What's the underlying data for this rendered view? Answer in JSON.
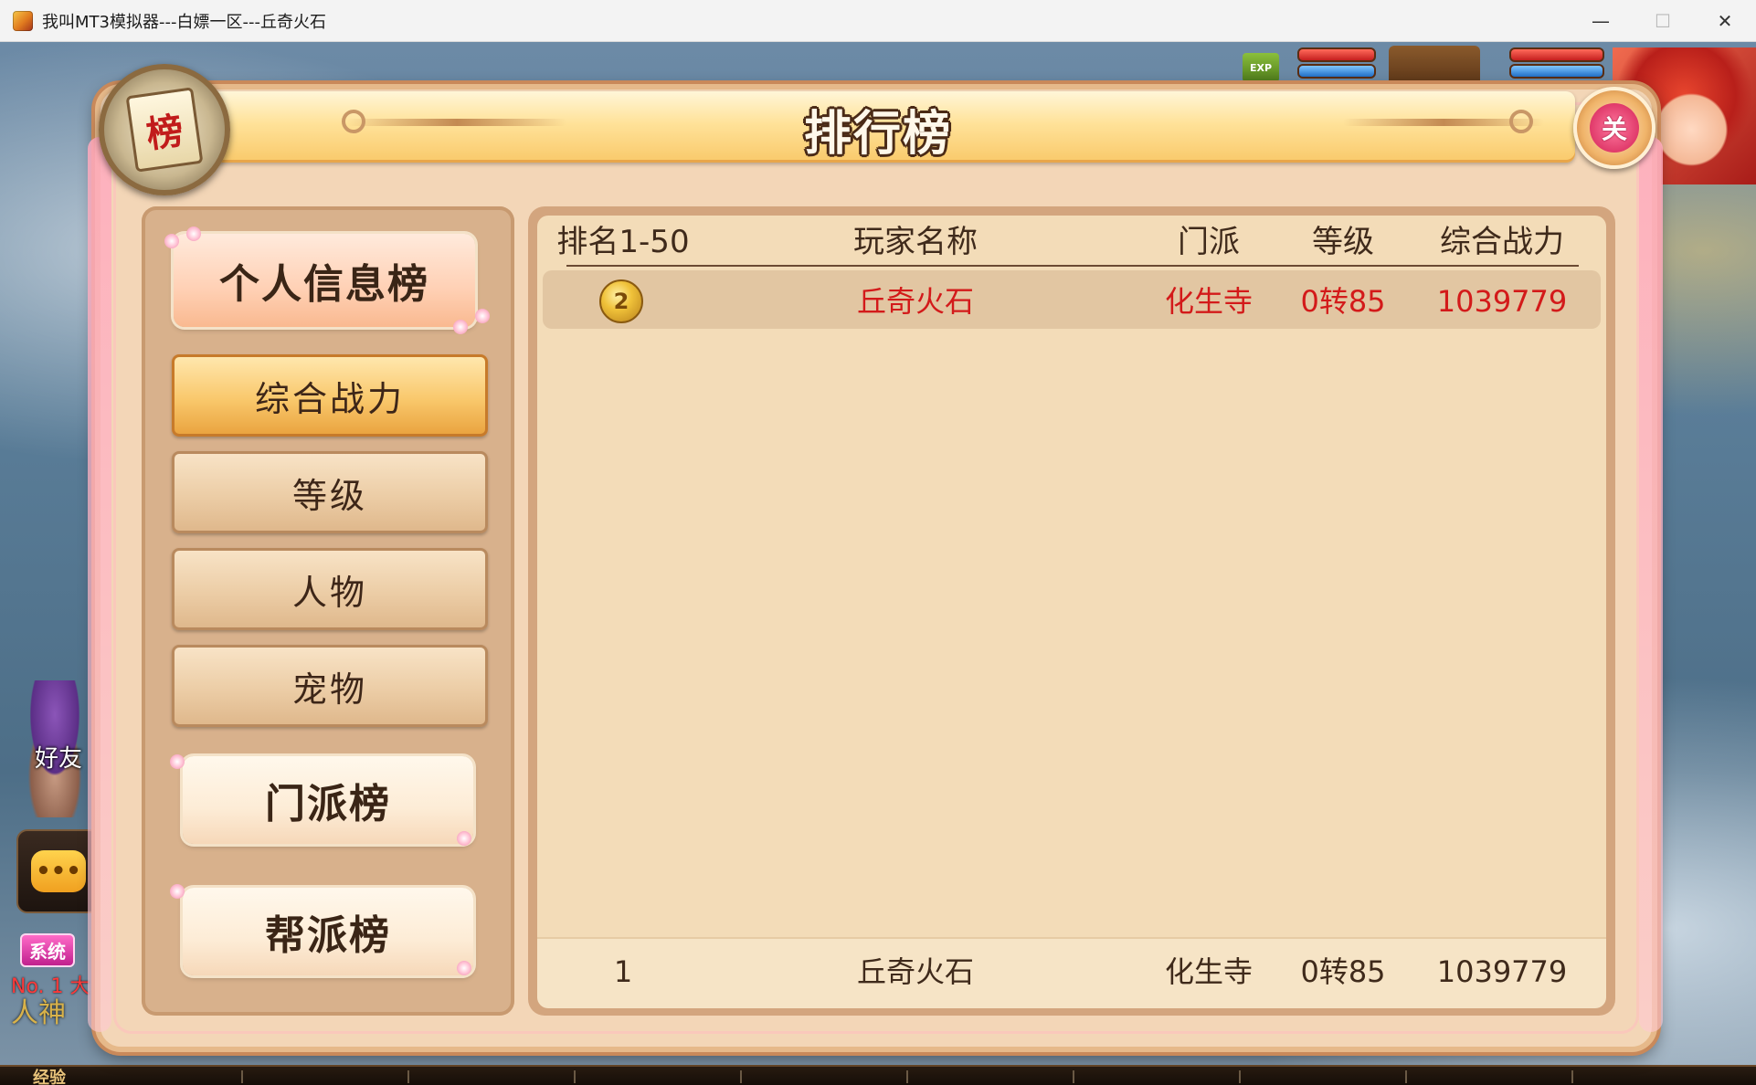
{
  "window": {
    "title": "我叫MT3模拟器---白嫖一区---丘奇火石",
    "minimize_glyph": "—",
    "maximize_glyph": "☐",
    "close_glyph": "✕"
  },
  "hud": {
    "exp_badge": "EXP",
    "friend_label": "好友",
    "chat_glyph": "•••",
    "system_badge": "系统",
    "chat_line": "No. 1 大",
    "chat_line2": "人神",
    "exp_bar_label": "经验"
  },
  "panel": {
    "title": "排行榜",
    "emblem_glyph": "榜",
    "close_label": "关"
  },
  "tabs": {
    "personal": "个人信息榜",
    "sub": [
      {
        "label": "综合战力",
        "active": true
      },
      {
        "label": "等级",
        "active": false
      },
      {
        "label": "人物",
        "active": false
      },
      {
        "label": "宠物",
        "active": false
      }
    ],
    "faction": "门派榜",
    "guild": "帮派榜"
  },
  "table": {
    "columns": [
      "排名1-50",
      "玩家名称",
      "门派",
      "等级",
      "综合战力"
    ],
    "rows": [
      {
        "rank_icon": "gold-medal-icon",
        "medal_glyph": "2",
        "name": "丘奇火石",
        "sect": "化生寺",
        "level": "0转85",
        "power": "1039779"
      }
    ],
    "my_rank": {
      "rank": "1",
      "name": "丘奇火石",
      "sect": "化生寺",
      "level": "0转85",
      "power": "1039779"
    }
  },
  "colors": {
    "highlight_text": "#d31a1a",
    "active_tab": "#f9c86c",
    "panel_bg": "#f3dcb8"
  }
}
